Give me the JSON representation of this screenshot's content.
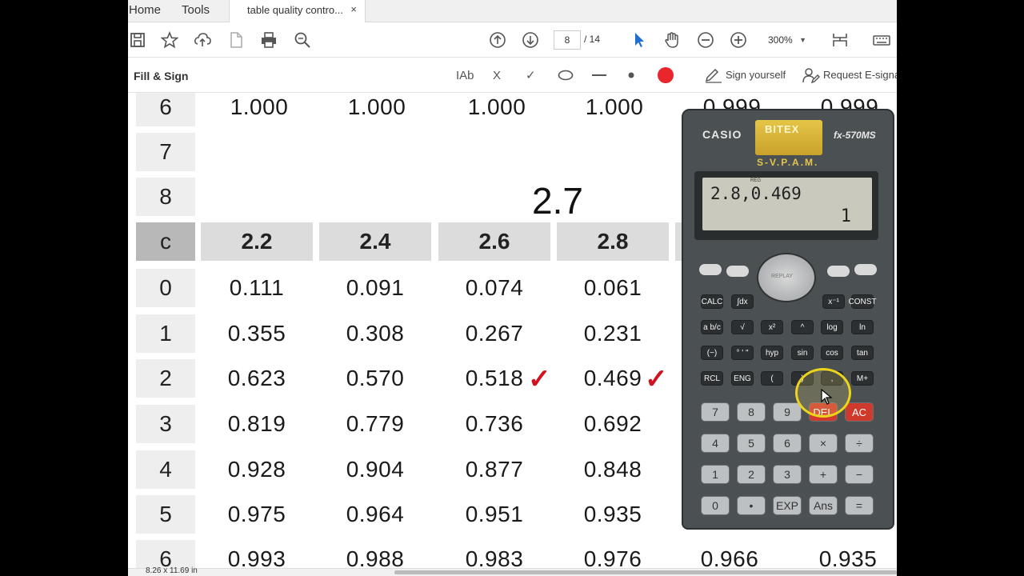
{
  "menu": {
    "home": "Home",
    "tools": "Tools"
  },
  "tab": {
    "title": "table quality contro...",
    "close": "×"
  },
  "toolbar": {
    "page_current": "8",
    "page_separator": "/ 14",
    "zoom": "300%",
    "icons": [
      "save-icon",
      "bookmark-star-icon",
      "upload-icon",
      "file-icon",
      "print-icon",
      "search-icon",
      "page-up-icon",
      "page-down-icon",
      "select-pointer-icon",
      "hand-icon",
      "zoom-out-icon",
      "zoom-in-icon",
      "page-view-icon",
      "keyboard-icon"
    ]
  },
  "fill_sign": {
    "title": "Fill & Sign",
    "text_tool": "IAb",
    "cross": "X",
    "check": "✓",
    "sign_yourself": "Sign yourself",
    "request": "Request E-signa",
    "color": "#e8262b"
  },
  "table": {
    "row_labels_top": [
      "6",
      "7",
      "8"
    ],
    "row6_values": [
      "1.000",
      "1.000",
      "1.000",
      "1.000",
      "0.999",
      "0.999"
    ],
    "header_label": "c",
    "header_values": [
      "2.2",
      "2.4",
      "2.6",
      "2.8"
    ],
    "rows": [
      {
        "label": "0",
        "values": [
          "0.111",
          "0.091",
          "0.074",
          "0.061"
        ]
      },
      {
        "label": "1",
        "values": [
          "0.355",
          "0.308",
          "0.267",
          "0.231"
        ]
      },
      {
        "label": "2",
        "values": [
          "0.623",
          "0.570",
          "0.518",
          "0.469"
        ]
      },
      {
        "label": "3",
        "values": [
          "0.819",
          "0.779",
          "0.736",
          "0.692"
        ]
      },
      {
        "label": "4",
        "values": [
          "0.928",
          "0.904",
          "0.877",
          "0.848"
        ]
      },
      {
        "label": "5",
        "values": [
          "0.975",
          "0.964",
          "0.951",
          "0.935"
        ]
      },
      {
        "label": "6",
        "values": [
          "0.993",
          "0.988",
          "0.983",
          "0.976",
          "0.966",
          "0.935"
        ]
      }
    ],
    "annotation": "2.7",
    "check_mark": "✓",
    "check_color": "#d1121f"
  },
  "status": {
    "page_size": "8.26 x 11.69 in"
  },
  "calculator": {
    "brand": "CASIO",
    "sticker": "BITEX",
    "model": "fx-570MS",
    "svpam": "S-V.P.A.M.",
    "display_reg": "REG",
    "display_line1": "2.8,0.469",
    "display_line2": "1",
    "replay": "REPLAY",
    "row1": [
      "CALC",
      "∫dx",
      "x⁻¹",
      "CONST"
    ],
    "row2": [
      "a b/c",
      "√",
      "x²",
      "^",
      "log",
      "ln"
    ],
    "row3": [
      "(−)",
      "° ' \"",
      "hyp",
      "sin",
      "cos",
      "tan"
    ],
    "row4": [
      "RCL",
      "ENG",
      "(",
      ")",
      ",",
      "M+"
    ],
    "num1": [
      "7",
      "8",
      "9",
      "DEL",
      "AC"
    ],
    "num2": [
      "4",
      "5",
      "6",
      "×",
      "÷"
    ],
    "num3": [
      "1",
      "2",
      "3",
      "+",
      "−"
    ],
    "num4": [
      "0",
      "•",
      "EXP",
      "Ans",
      "="
    ]
  }
}
